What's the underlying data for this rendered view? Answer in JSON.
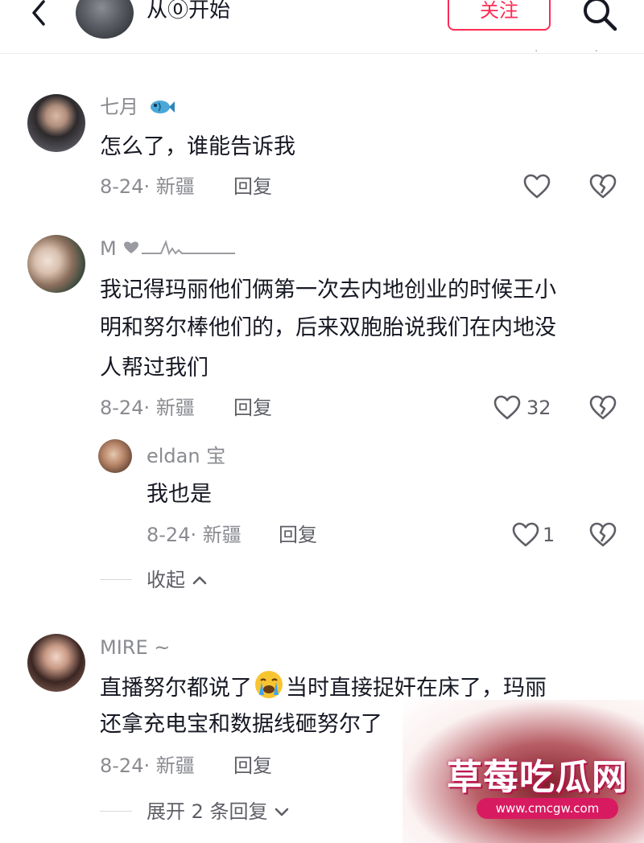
{
  "header": {
    "title": "从⓪开始",
    "follow_label": "关注"
  },
  "comments": [
    {
      "username": "七月",
      "text": "怎么了，谁能告诉我",
      "meta": "8-24· 新疆",
      "reply_label": "回复"
    },
    {
      "username": "M",
      "text_lines": [
        "我记得玛丽他们俩第一次去内地创业的时候王小",
        "明和努尔棒他们的，后来双胞胎说我们在内地没",
        "人帮过我们"
      ],
      "meta": "8-24· 新疆",
      "reply_label": "回复",
      "like_count": "32",
      "replies": [
        {
          "username": "eldan 宝",
          "text": "我也是",
          "meta": "8-24· 新疆",
          "reply_label": "回复",
          "like_count": "1"
        }
      ],
      "collapse_label": "收起"
    },
    {
      "username": "MIRE ~",
      "text_line1_before": "直播努尔都说了",
      "text_line1_after": "当时直接捉奸在床了，玛丽",
      "text_line2": "还拿充电宝和数据线砸努尔了",
      "meta": "8-24· 新疆",
      "reply_label": "回复",
      "expand_label": "展开 2 条回复"
    }
  ],
  "watermark": {
    "title": "草莓吃瓜网",
    "url": "www.cmcgw.com"
  },
  "colors": {
    "accent": "#fe2c55",
    "secondary_text": "#8a8b91"
  }
}
